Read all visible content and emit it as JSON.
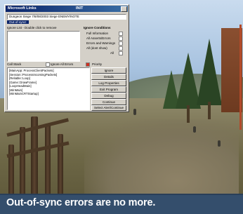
{
  "dialog": {
    "title": "Microsoft Links",
    "title_extra": "INIT",
    "path_text": "Dungeon Siege 7/8/08/2003 Siege ENEMY/NOTE",
    "status_text": "Out-of-sync!",
    "ignore_label": "Ignore List - Double click to remove",
    "ignore_section": "Ignore Conditions",
    "options": [
      "Full Information",
      "All Asserts/Errors",
      "Errors and Warnings",
      "All (dont show)"
    ],
    "option_all_label": "All",
    "call_stack_label": "Call Stack",
    "ignore_all_label": "Ignore All Errors",
    "priority_label": "Priority",
    "call_stack": [
      "[MainApp: ProcessClientPackets]",
      "[Session::ProcessIncomingPackets]",
      "[Reliable::Loop]",
      "[Game::DrawFrame]",
      "[LoopHeadMain]",
      "[WinMain]",
      "[WinMainCRTStartup]"
    ],
    "buttons": [
      "Ignore",
      "Details",
      "Log Properties",
      "Exit Program",
      "Debug",
      "Continue",
      "Select Alert/Continue"
    ]
  },
  "caption": {
    "text": "Out-of-sync errors are no more.",
    "bg_color": "#344e6c"
  }
}
